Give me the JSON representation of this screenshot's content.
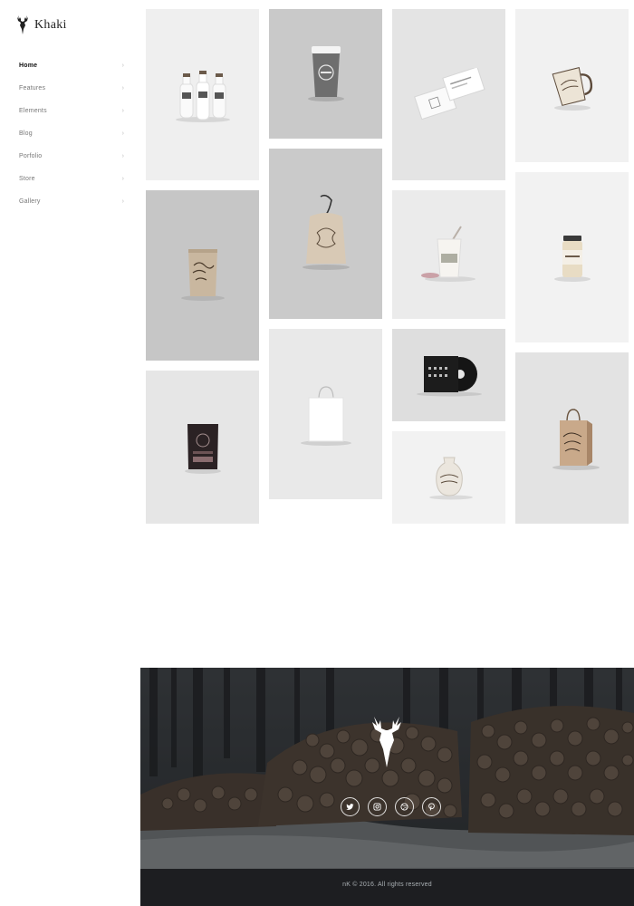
{
  "brand": {
    "name": "Khaki",
    "logo_icon": "deer-head-icon"
  },
  "nav": {
    "items": [
      {
        "label": "Home",
        "active": true
      },
      {
        "label": "Features",
        "active": false
      },
      {
        "label": "Elements",
        "active": false
      },
      {
        "label": "Blog",
        "active": false
      },
      {
        "label": "Porfolio",
        "active": false
      },
      {
        "label": "Store",
        "active": false
      },
      {
        "label": "Gallery",
        "active": false
      }
    ],
    "chevron_icon": "chevron-right-icon"
  },
  "gallery": {
    "items": [
      {
        "subject": "milk-bottles",
        "background": "#efefef"
      },
      {
        "subject": "coffee-cup",
        "background": "#c9c9c9"
      },
      {
        "subject": "business-cards",
        "background": "#e4e4e4"
      },
      {
        "subject": "enamel-mug",
        "background": "#f1f1f1"
      },
      {
        "subject": "drawstring-bag",
        "background": "#cacaca"
      },
      {
        "subject": "coffee-pouch",
        "background": "#c6c6c6"
      },
      {
        "subject": "smoothie-cup",
        "background": "#ebebeb"
      },
      {
        "subject": "glass-jar",
        "background": "#f2f2f2"
      },
      {
        "subject": "vinyl-record",
        "background": "#dedede"
      },
      {
        "subject": "paper-bag",
        "background": "#e9e9e9"
      },
      {
        "subject": "dark-pouch",
        "background": "#e6e6e6"
      },
      {
        "subject": "ceramic-vase",
        "background": "#f2f2f2"
      },
      {
        "subject": "kraft-shopping-bag",
        "background": "#e3e3e3"
      }
    ]
  },
  "footer": {
    "logo_icon": "deer-head-icon",
    "social": [
      {
        "name": "twitter-icon"
      },
      {
        "name": "instagram-icon"
      },
      {
        "name": "dribbble-icon"
      },
      {
        "name": "pinterest-icon"
      }
    ],
    "copyright": "nK © 2016. All rights reserved"
  }
}
